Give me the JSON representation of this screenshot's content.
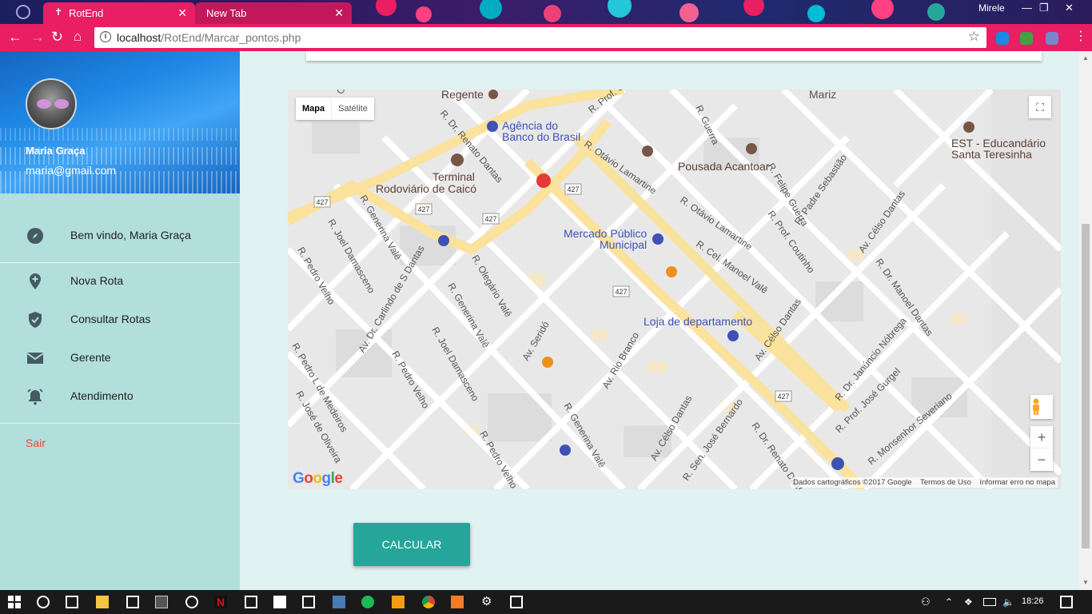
{
  "browser": {
    "tabs": [
      {
        "label": "RotEnd",
        "active": true
      },
      {
        "label": "New Tab",
        "active": false
      }
    ],
    "profile": "Mirele",
    "url_host": "localhost",
    "url_path": "/RotEnd/Marcar_pontos.php"
  },
  "user": {
    "name": "Maria Graça",
    "email": "maria@gmail.com"
  },
  "menu": {
    "items": [
      {
        "label": "Bem vindo, Maria Graça",
        "icon": "compass-icon"
      },
      {
        "label": "Nova Rota",
        "icon": "add-location-icon"
      },
      {
        "label": "Consultar Rotas",
        "icon": "verified-shield-icon"
      },
      {
        "label": "Gerente",
        "icon": "mail-icon"
      },
      {
        "label": "Atendimento",
        "icon": "alarm-bell-icon"
      }
    ],
    "logout": "Sair"
  },
  "map": {
    "type_controls": [
      "Mapa",
      "Satélite"
    ],
    "selected_type": "Mapa",
    "labels": [
      "Regente",
      "Mariz",
      "Agência do",
      "Banco do Brasil",
      "Terminal",
      "Rodoviário de Caicó",
      "Pousada Acantoar",
      "EST - Educandário",
      "Santa Teresinha",
      "Mercado Público",
      "Municipal",
      "Loja de departamento"
    ],
    "road_shield": "427",
    "footer": [
      "Dados cartográficos ©2017 Google",
      "Termos de Uso",
      "Informar erro no mapa"
    ],
    "logo": "Google"
  },
  "action": {
    "calc_label": "CALCULAR"
  },
  "taskbar": {
    "time": "18:26"
  },
  "colors": {
    "accent": "#e91e63",
    "sidebar": "#b2dfdb",
    "button": "#26a69a",
    "logout": "#f44336"
  }
}
